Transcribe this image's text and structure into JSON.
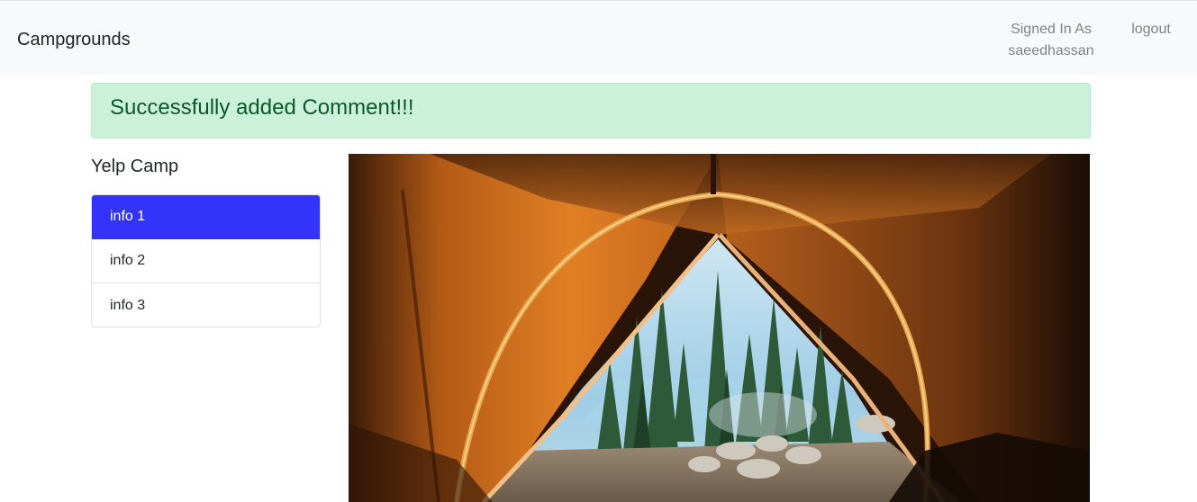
{
  "navbar": {
    "brand": "Campgrounds",
    "signed_in_line1": "Signed In As",
    "signed_in_line2": "saeedhassan",
    "logout": "logout"
  },
  "alert": {
    "message": "Successfully added Comment!!!",
    "color": "#ccf1da"
  },
  "sidebar": {
    "title": "Yelp Camp",
    "items": [
      {
        "label": "info 1",
        "active": true
      },
      {
        "label": "info 2",
        "active": false
      },
      {
        "label": "info 3",
        "active": false
      }
    ],
    "active_color": "#3333fa"
  },
  "main": {
    "image": "tent-interior-forest-photo"
  }
}
